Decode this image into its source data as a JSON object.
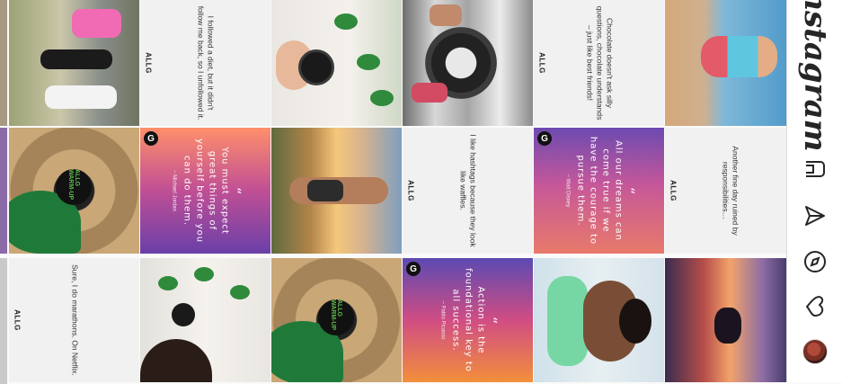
{
  "app": {
    "name": "Instagram"
  },
  "sidebar": {
    "icons": [
      {
        "name": "home-icon"
      },
      {
        "name": "direct-icon"
      },
      {
        "name": "explore-icon"
      },
      {
        "name": "activity-icon"
      },
      {
        "name": "profile-avatar"
      }
    ]
  },
  "posts": {
    "caption_chocolate": "Chocolate doesn't ask silly questions, chocolate understands – just like best friends!",
    "caption_diet": "I followed a diet, but it didn't follow me back, so I unfollowed it.",
    "caption_hashtags": "I like hashtags because they look like waffles.",
    "caption_tired": "Another fine day ruined by responsibilities…",
    "caption_netflix": "Sure, I do marathons. On Netflix.",
    "brand_mark": "ALLG",
    "quote_dreams": "All our dreams can come true if we have the courage to pursue them.",
    "quote_dreams_author": "– Walt Disney",
    "quote_expect": "You must expect great things of yourself before you can do them.",
    "quote_expect_author": "– Michael Jordan",
    "quote_action": "Action is the foundational key to all success.",
    "quote_action_author": "– Pablo Picasso",
    "badge": "G",
    "warmup_label": "ALLG WARM-UP"
  },
  "colors": {
    "accent_green": "#5fb84b",
    "quote_pink": "#c5579a",
    "quote_purple": "#6c4ab0",
    "quote_orange": "#f38f3b"
  }
}
